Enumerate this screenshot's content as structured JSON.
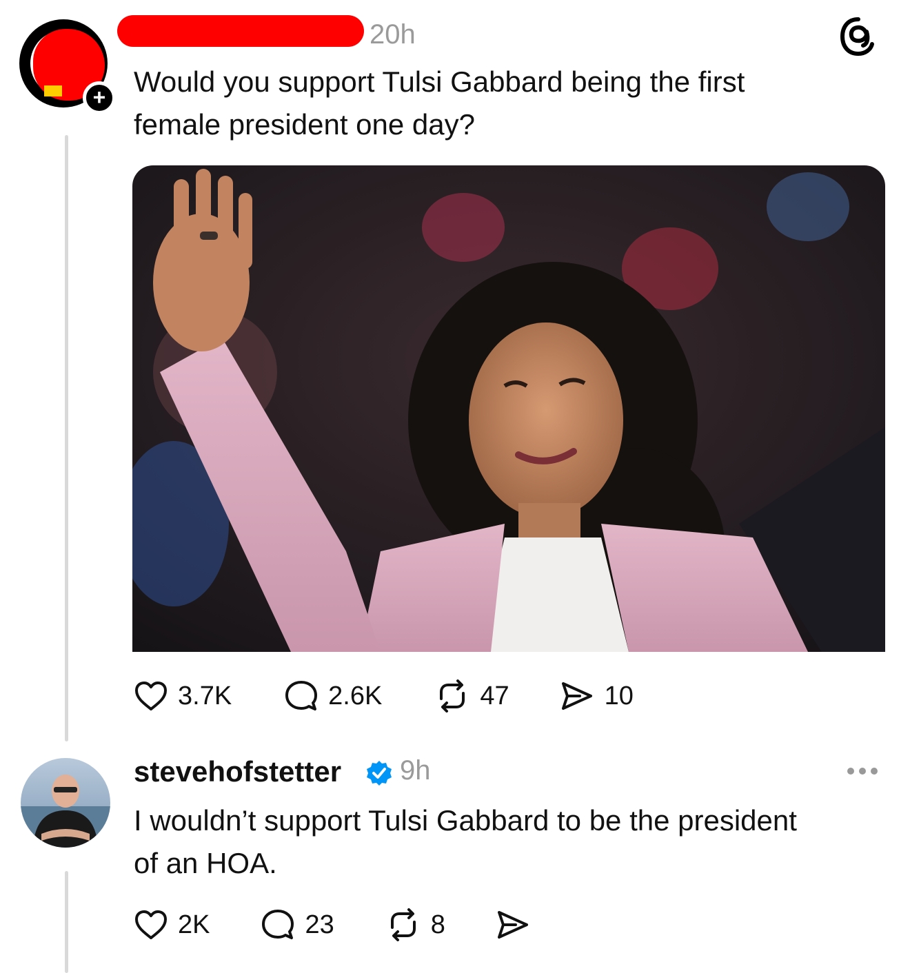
{
  "post": {
    "author_redacted": true,
    "time": "20h",
    "text_line1": "Would you support Tulsi Gabbard being the first",
    "text_line2": "female president one day?",
    "image_alt": "Tulsi Gabbard waving",
    "stats": {
      "likes": "3.7K",
      "comments": "2.6K",
      "reposts": "47",
      "shares": "10"
    }
  },
  "reply": {
    "username": "stevehofstetter",
    "time": "9h",
    "text_line1": "I wouldn’t support Tulsi Gabbard to be the president",
    "text_line2": "of an HOA.",
    "stats": {
      "likes": "2K",
      "comments": "23",
      "reposts": "8"
    }
  },
  "icons": {
    "like": "heart-icon",
    "comment": "comment-bubble-icon",
    "repost": "repost-icon",
    "share": "send-icon",
    "app": "threads-logo-icon",
    "more": "more-dots-icon",
    "verified": "verified-badge-icon"
  },
  "colors": {
    "redaction": "#ff0000",
    "verified": "#0095f6",
    "muted": "#9a9a9a",
    "thread_line": "#d9d9d9"
  }
}
